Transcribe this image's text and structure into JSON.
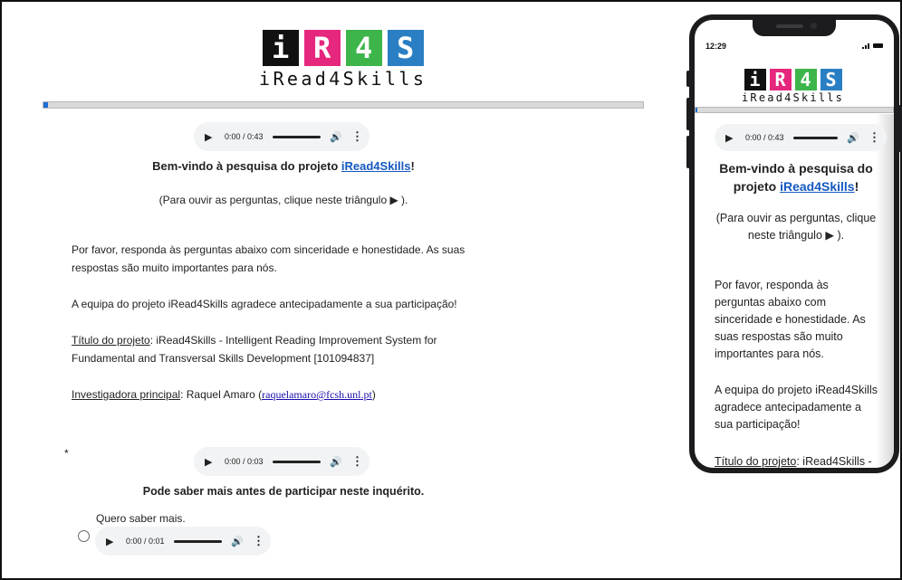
{
  "logo": {
    "tiles": [
      {
        "char": "i",
        "color": "#111111"
      },
      {
        "char": "R",
        "color": "#e5287e"
      },
      {
        "char": "4",
        "color": "#3db54a"
      },
      {
        "char": "S",
        "color": "#2a7fc4"
      }
    ],
    "word": "iRead4Skills"
  },
  "progress": {
    "value_percent": 0.7
  },
  "desktop": {
    "intro_audio": {
      "time": "0:00 / 0:43"
    },
    "welcome_prefix": "Bem-vindo à pesquisa do projeto ",
    "welcome_link": "iRead4Skills",
    "welcome_suffix": "!",
    "listen_hint": "(Para ouvir as perguntas, clique neste triângulo  ▶ ).",
    "para1_line1": "Por favor, responda às perguntas abaixo com sinceridade e honestidade. As suas",
    "para1_line2": "respostas são muito importantes para nós.",
    "para2": "A equipa do projeto iRead4Skills agradece antecipadamente a sua participação!",
    "project_title_label": "Título do projeto",
    "project_title_line1": ":  iRead4Skills - Intelligent Reading Improvement System for",
    "project_title_line2": "Fundamental and Transversal Skills Development [101094837]",
    "investigator_label": "Investigadora principal",
    "investigator_name": ": Raquel Amaro (",
    "investigator_email": "raquelamaro@fcsh.unl.pt",
    "investigator_close": ")",
    "required_mark": "*",
    "question_audio": {
      "time": "0:00 / 0:03"
    },
    "question": "Pode saber mais antes de participar neste inquérito.",
    "option1_label": "Quero saber mais.",
    "option1_audio": {
      "time": "0:00 / 0:01"
    }
  },
  "phone": {
    "status_time": "12:29",
    "audio": {
      "time": "0:00 / 0:43"
    },
    "welcome_line1": "Bem-vindo à pesquisa do",
    "welcome_line2_prefix": "projeto ",
    "welcome_link": "iRead4Skills",
    "welcome_suffix": "!",
    "hint_line1": "(Para ouvir as perguntas, clique",
    "hint_line2": "neste triângulo  ▶ ).",
    "para1": [
      "Por favor, responda às",
      "perguntas abaixo com",
      "sinceridade e honestidade. As",
      "suas respostas são muito",
      "importantes para nós."
    ],
    "para2": [
      "A equipa do projeto iRead4Skills",
      "agradece antecipadamente a",
      "sua participação!"
    ],
    "project_title_label": "Título do projeto",
    "project_title_rest": ":  iRead4Skills -"
  },
  "audio_icons": {
    "play": "▶",
    "volume": "🔊",
    "more": "⋮"
  }
}
